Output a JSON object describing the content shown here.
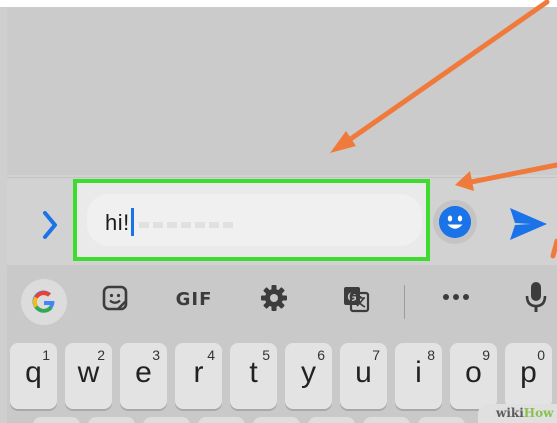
{
  "compose": {
    "message_text": "hi!"
  },
  "toolbar": {
    "items": [
      {
        "name": "google",
        "icon": "google-g-icon"
      },
      {
        "name": "stickers",
        "icon": "sticker-icon"
      },
      {
        "name": "gif",
        "label": "GIF"
      },
      {
        "name": "settings",
        "icon": "gear-icon"
      },
      {
        "name": "translate",
        "icon": "translate-icon"
      },
      {
        "name": "more",
        "icon": "more-horizontal-icon"
      },
      {
        "name": "voice",
        "icon": "microphone-icon"
      }
    ]
  },
  "keys": [
    {
      "letter": "q",
      "digit": "1"
    },
    {
      "letter": "w",
      "digit": "2"
    },
    {
      "letter": "e",
      "digit": "3"
    },
    {
      "letter": "r",
      "digit": "4"
    },
    {
      "letter": "t",
      "digit": "5"
    },
    {
      "letter": "y",
      "digit": "6"
    },
    {
      "letter": "u",
      "digit": "7"
    },
    {
      "letter": "i",
      "digit": "8"
    },
    {
      "letter": "o",
      "digit": "9"
    },
    {
      "letter": "p",
      "digit": "0"
    }
  ],
  "watermark": {
    "wiki": "wiki",
    "how": "How"
  },
  "colors": {
    "highlight": "#3ddc2e",
    "accent": "#1a73e8",
    "arrow": "#f07a3c"
  }
}
